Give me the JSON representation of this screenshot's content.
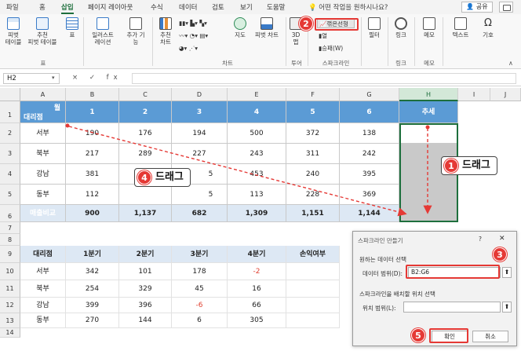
{
  "ribbon": {
    "tabs": [
      "파일",
      "홈",
      "삽입",
      "페이지 레이아웃",
      "수식",
      "데이터",
      "검토",
      "보기",
      "도움말"
    ],
    "active_tab": "삽입",
    "tell_me": "어떤 작업을 원하시나요?",
    "share": "공유",
    "buttons": {
      "pivot": "피벗\n테이블",
      "rec_pivot": "추천\n피벗 테이블",
      "table": "표",
      "illustrations": "일러스트\n레이션",
      "addins": "추가 기\n능",
      "rec_charts": "추천\n차트",
      "maps": "지도",
      "pivot_chart": "피벗 차트",
      "map3d": "3D\n맵",
      "spark_line": "꺾은선형",
      "spark_column": "열",
      "spark_winloss": "승패(W)",
      "filter": "필터",
      "link": "링크",
      "comment": "메모",
      "text": "텍스트",
      "symbol": "기호"
    },
    "groups": {
      "tables": "표",
      "charts": "차트",
      "tours": "투어",
      "sparklines": "스파크라인",
      "links": "링크",
      "comments": "메모"
    }
  },
  "formula_bar": {
    "name_box": "H2",
    "fx": "× ✓ fx"
  },
  "columns": [
    "A",
    "B",
    "C",
    "D",
    "E",
    "F",
    "G",
    "H",
    "I",
    "J"
  ],
  "rows": [
    "1",
    "2",
    "3",
    "4",
    "5",
    "6",
    "7",
    "8",
    "9",
    "10",
    "11",
    "12",
    "13",
    "14"
  ],
  "table1": {
    "header_top": "월",
    "header_bottom": "대리점",
    "months": [
      "1",
      "2",
      "3",
      "4",
      "5",
      "6"
    ],
    "trend": "추세",
    "rows": [
      {
        "name": "서부",
        "values": [
          "190",
          "176",
          "194",
          "500",
          "372",
          "138"
        ]
      },
      {
        "name": "북부",
        "values": [
          "217",
          "289",
          "227",
          "243",
          "311",
          "242"
        ]
      },
      {
        "name": "강남",
        "values": [
          "381",
          "",
          "",
          "453",
          "240",
          "395"
        ]
      },
      {
        "name": "동부",
        "values": [
          "112",
          "",
          "",
          "113",
          "228",
          "369"
        ]
      }
    ],
    "total": {
      "name": "매출비교",
      "values": [
        "900",
        "1,137",
        "682",
        "1,309",
        "1,151",
        "1,144"
      ]
    },
    "partial_hidden": [
      "5",
      "5"
    ]
  },
  "table2": {
    "headers": [
      "대리점",
      "1분기",
      "2분기",
      "3분기",
      "4분기",
      "손익여부"
    ],
    "rows": [
      [
        "서부",
        "342",
        "101",
        "178",
        "-2",
        ""
      ],
      [
        "북부",
        "254",
        "329",
        "45",
        "16",
        ""
      ],
      [
        "강남",
        "399",
        "396",
        "-6",
        "66",
        ""
      ],
      [
        "동부",
        "270",
        "144",
        "6",
        "305",
        ""
      ]
    ]
  },
  "dialog": {
    "title": "스파크라인 만들기",
    "help": "?",
    "section1": "원하는 데이터 선택",
    "data_range_label": "데이터 범위(D):",
    "data_range_value": "B2:G6",
    "section2": "스파크라인을 배치할 위치 선택",
    "location_label": "위치 범위(L):",
    "location_value": "",
    "ok": "확인",
    "cancel": "취소"
  },
  "annotations": {
    "step1": "1",
    "step1_text": "드래그",
    "step2": "2",
    "step3": "3",
    "step4": "4",
    "step4_text": "드래그",
    "step5": "5"
  },
  "colors": {
    "accent": "#1e6f3d",
    "header_blue": "#5b9bd5",
    "annotation_red": "#e53935"
  }
}
